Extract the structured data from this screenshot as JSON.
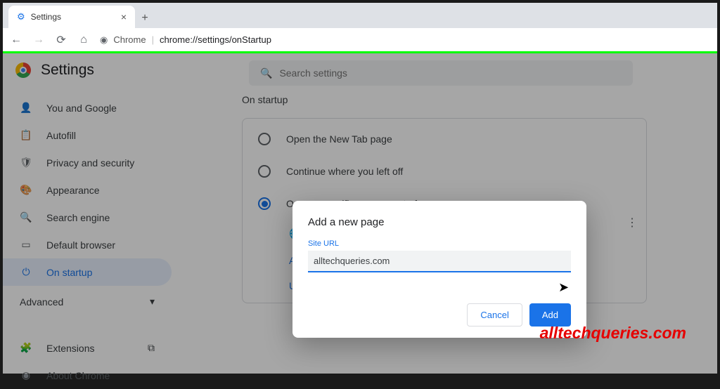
{
  "browser": {
    "tab_title": "Settings",
    "address_host": "Chrome",
    "address_path": "chrome://settings/onStartup"
  },
  "header": {
    "title": "Settings",
    "search_placeholder": "Search settings"
  },
  "sidebar": {
    "items": [
      {
        "label": "You and Google"
      },
      {
        "label": "Autofill"
      },
      {
        "label": "Privacy and security"
      },
      {
        "label": "Appearance"
      },
      {
        "label": "Search engine"
      },
      {
        "label": "Default browser"
      },
      {
        "label": "On startup"
      }
    ],
    "advanced": "Advanced",
    "extensions": "Extensions",
    "about": "About Chrome"
  },
  "main": {
    "section_title": "On startup",
    "options": [
      "Open the New Tab page",
      "Continue where you left off",
      "Open a specific page or set of pages"
    ],
    "add_link": "Add",
    "use_link": "Use"
  },
  "dialog": {
    "title": "Add a new page",
    "field_label": "Site URL",
    "field_value": "alltechqueries.com",
    "cancel": "Cancel",
    "confirm": "Add"
  },
  "watermark": "alltechqueries.com"
}
